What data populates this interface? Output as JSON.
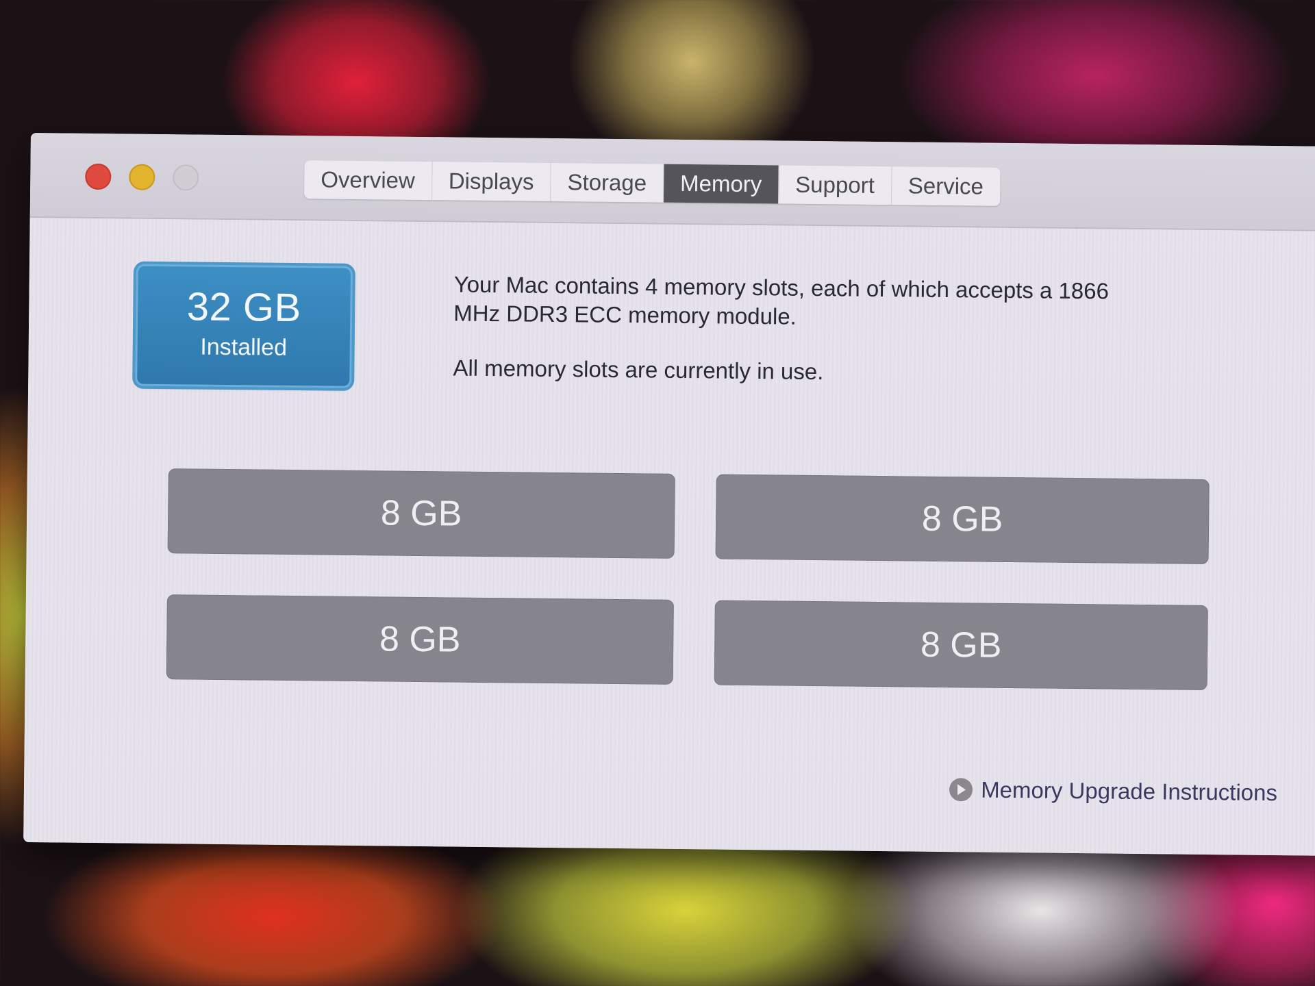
{
  "window": {
    "traffic_lights": [
      "close",
      "minimize",
      "zoom"
    ],
    "tabs": [
      {
        "label": "Overview",
        "active": false
      },
      {
        "label": "Displays",
        "active": false
      },
      {
        "label": "Storage",
        "active": false
      },
      {
        "label": "Memory",
        "active": true
      },
      {
        "label": "Support",
        "active": false
      },
      {
        "label": "Service",
        "active": false
      }
    ]
  },
  "memory": {
    "installed_size": "32 GB",
    "installed_label": "Installed",
    "description_line1": "Your Mac contains 4 memory slots, each of which accepts a 1866 MHz DDR3 ECC memory module.",
    "description_line2": "All memory slots are currently in use.",
    "slots": [
      "8 GB",
      "8 GB",
      "8 GB",
      "8 GB"
    ],
    "upgrade_link": "Memory Upgrade Instructions"
  },
  "colors": {
    "installed_badge": "#2f78ad",
    "slot_fill": "#86848c",
    "active_tab": "#55545a",
    "close": "#e04a3e",
    "minimize": "#e3b52f"
  }
}
